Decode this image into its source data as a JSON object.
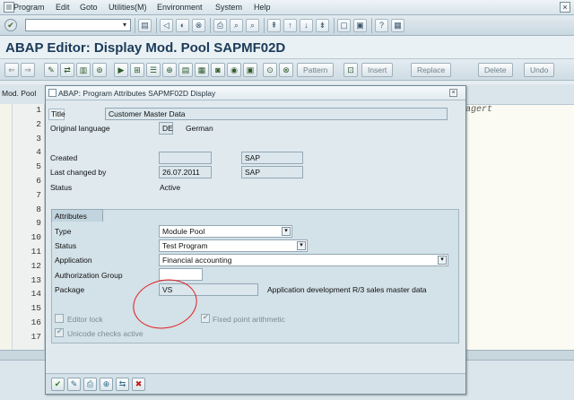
{
  "menu": {
    "items": [
      "Program",
      "Edit",
      "Goto",
      "Utilities(M)",
      "Environment",
      "System",
      "Help"
    ]
  },
  "title": "ABAP Editor: Display Mod. Pool SAPMF02D",
  "app_toolbar": {
    "pattern": "Pattern",
    "insert": "Insert",
    "replace": "Replace",
    "delete": "Delete",
    "undo": "Undo"
  },
  "editor": {
    "mode_label": "Mod. Pool",
    "line_numbers": [
      "1",
      "2",
      "3",
      "4",
      "5",
      "6",
      "7",
      "8",
      "9",
      "10",
      "11",
      "12",
      "13",
      "14",
      "15",
      "16",
      "17"
    ],
    "right_text": "agert"
  },
  "dialog": {
    "title": "ABAP: Program Attributes SAPMF02D Display",
    "title_label": "Title",
    "title_value": "Customer Master Data",
    "orig_lang_label": "Original language",
    "orig_lang_code": "DE",
    "orig_lang_name": "German",
    "created_label": "Created",
    "created_date": "",
    "created_user": "SAP",
    "last_changed_label": "Last changed by",
    "last_changed_date": "26.07.2011",
    "last_changed_user": "SAP",
    "status_label": "Status",
    "status_value": "Active",
    "attributes": {
      "group_label": "Attributes",
      "type_label": "Type",
      "type_value": "Module Pool",
      "status_label": "Status",
      "status_value": "Test Program",
      "application_label": "Application",
      "application_value": "Financial accounting",
      "auth_group_label": "Authorization Group",
      "auth_group_value": "",
      "package_label": "Package",
      "package_value": "VS",
      "package_desc": "Application development R/3 sales master data",
      "editor_lock_label": "Editor lock",
      "fixed_point_label": "Fixed point arithmetic",
      "unicode_label": "Unicode checks active"
    }
  },
  "colors": {
    "title_text": "#1b3b5a",
    "annotation": "#e11c1c"
  }
}
